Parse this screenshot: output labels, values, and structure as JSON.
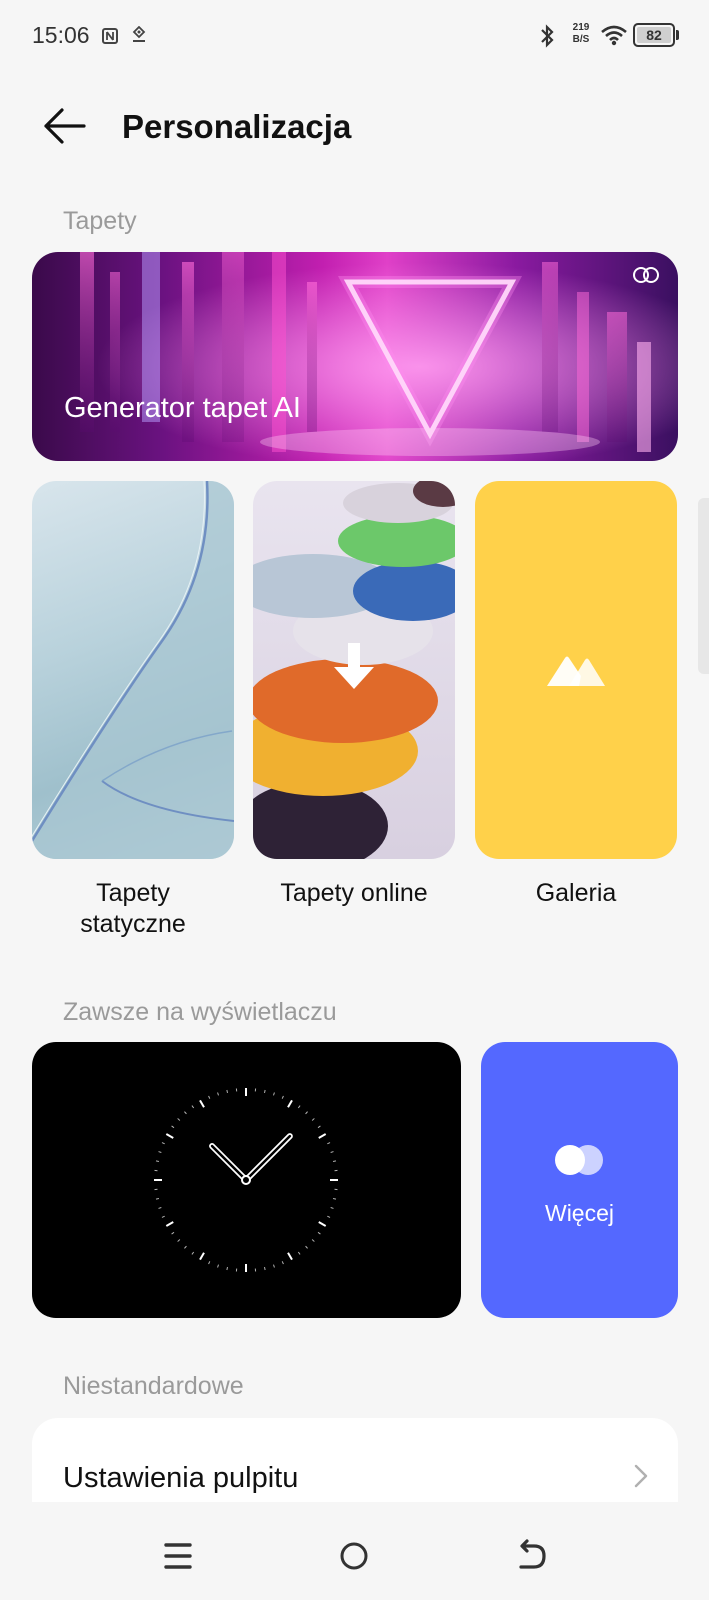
{
  "status_bar": {
    "time": "15:06",
    "net_speed_value": "219",
    "net_speed_unit": "B/S",
    "battery": "82"
  },
  "header": {
    "title": "Personalizacja"
  },
  "sections": {
    "wallpapers": "Tapety",
    "always_on": "Zawsze na wyświetlaczu",
    "custom": "Niestandardowe"
  },
  "ai_banner": {
    "label": "Generator tapet AI"
  },
  "wallpaper_tiles": [
    {
      "line1": "Tapety",
      "line2": "statyczne"
    },
    {
      "line1": "Tapety online",
      "line2": ""
    },
    {
      "line1": "Galeria",
      "line2": ""
    }
  ],
  "aod": {
    "more_label": "Więcej"
  },
  "settings": {
    "desktop_label": "Ustawienia pulpitu"
  },
  "icons": {
    "back": "arrow-left-icon",
    "download": "download-icon",
    "gallery": "mountains-icon",
    "more": "two-circles-icon",
    "chevron": "chevron-right-icon"
  },
  "colors": {
    "background": "#f6f6f6",
    "gallery_tile": "#ffd14a",
    "more_tile": "#5468ff",
    "aod_tile": "#000000"
  }
}
